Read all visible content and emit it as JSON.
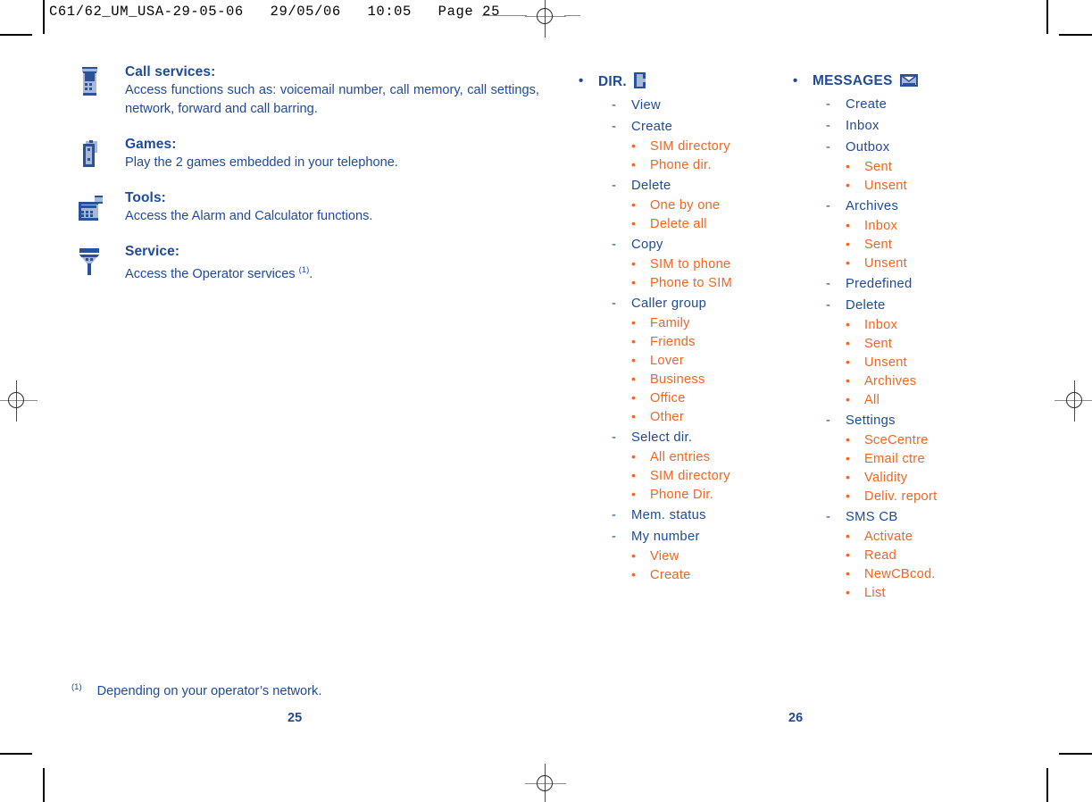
{
  "header": {
    "imposition_text": "C61/62_UM_USA-29-05-06   29/05/06   10:05   Page 25"
  },
  "left_column": {
    "features": [
      {
        "icon": "mobile-phone-icon",
        "title": "Call services:",
        "body": "Access functions such as: voicemail number, call memory, call settings, network, forward and call barring."
      },
      {
        "icon": "dice-games-icon",
        "title": "Games:",
        "body": "Play the 2 games embedded in your telephone."
      },
      {
        "icon": "calculator-tools-icon",
        "title": "Tools:",
        "body": "Access the Alarm and Calculator functions."
      },
      {
        "icon": "antenna-service-icon",
        "title": "Service:",
        "body": "Access the Operator services ",
        "footnote_ref": "(1)",
        "body_tail": "."
      }
    ]
  },
  "middle_column": {
    "heading": "DIR.",
    "heading_icon": "directory-card-icon",
    "bullet_glyph": "•",
    "dash_glyph": "-",
    "items": [
      {
        "label": "View",
        "children": []
      },
      {
        "label": "Create",
        "children": [
          "SIM directory",
          "Phone dir."
        ]
      },
      {
        "label": "Delete",
        "children": [
          "One by one",
          "Delete all"
        ]
      },
      {
        "label": "Copy",
        "children": [
          "SIM to phone",
          "Phone to SIM"
        ]
      },
      {
        "label": "Caller group",
        "children": [
          "Family",
          "Friends",
          "Lover",
          "Business",
          "Office",
          "Other"
        ]
      },
      {
        "label": "Select dir.",
        "children": [
          "All entries",
          "SIM directory",
          "Phone Dir."
        ]
      },
      {
        "label": "Mem. status",
        "children": []
      },
      {
        "label": "My number",
        "children": [
          "View",
          "Create"
        ]
      }
    ]
  },
  "right_column": {
    "heading": "MESSAGES",
    "heading_icon": "envelope-message-icon",
    "bullet_glyph": "•",
    "dash_glyph": "-",
    "items": [
      {
        "label": "Create",
        "children": []
      },
      {
        "label": "Inbox",
        "children": []
      },
      {
        "label": "Outbox",
        "children": [
          "Sent",
          "Unsent"
        ]
      },
      {
        "label": "Archives",
        "children": [
          "Inbox",
          "Sent",
          "Unsent"
        ]
      },
      {
        "label": "Predefined",
        "children": []
      },
      {
        "label": "Delete",
        "children": [
          "Inbox",
          "Sent",
          "Unsent",
          "Archives",
          "All"
        ]
      },
      {
        "label": "Settings",
        "children": [
          "SceCentre",
          "Email ctre",
          "Validity",
          "Deliv. report"
        ]
      },
      {
        "label": "SMS CB",
        "children": [
          "Activate",
          "Read",
          "NewCBcod.",
          "List"
        ]
      }
    ]
  },
  "footer": {
    "footnote_marker": "(1)",
    "footnote_text": "Depending on your operator’s network.",
    "page_left": "25",
    "page_right": "26"
  },
  "colors": {
    "blue": "#1f4a99",
    "orange": "#f26522",
    "icon_light": "#a8b8d8",
    "mark": "#000000"
  }
}
